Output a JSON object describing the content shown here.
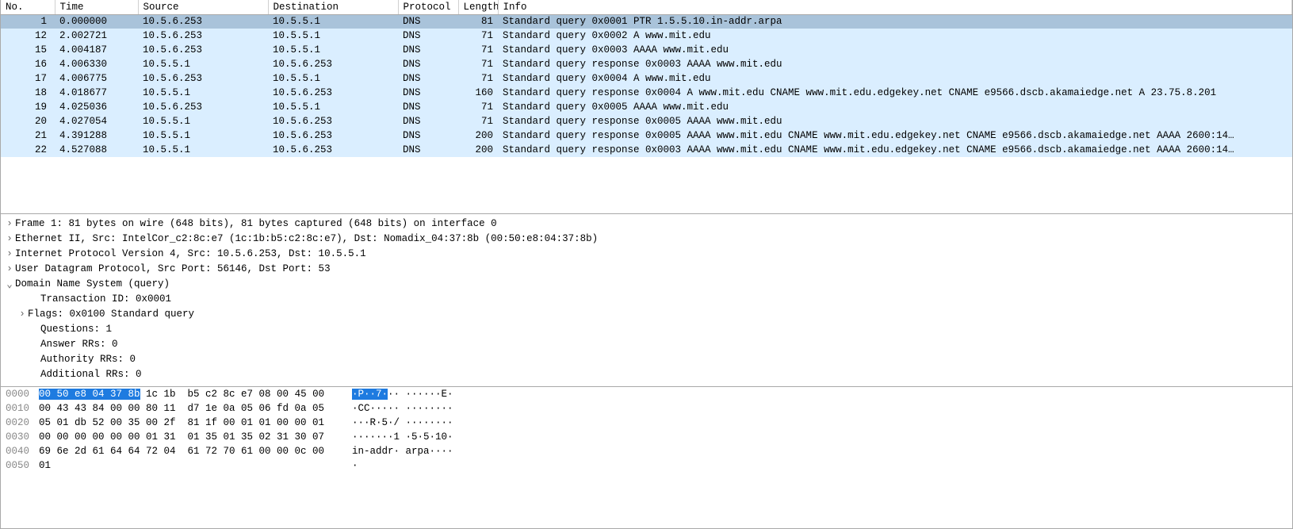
{
  "columns": {
    "no": "No.",
    "time": "Time",
    "src": "Source",
    "dst": "Destination",
    "proto": "Protocol",
    "len": "Length",
    "info": "Info"
  },
  "packets": [
    {
      "no": "1",
      "time": "0.000000",
      "src": "10.5.6.253",
      "dst": "10.5.5.1",
      "proto": "DNS",
      "len": "81",
      "info": "Standard query 0x0001 PTR 1.5.5.10.in-addr.arpa",
      "sel": true
    },
    {
      "no": "12",
      "time": "2.002721",
      "src": "10.5.6.253",
      "dst": "10.5.5.1",
      "proto": "DNS",
      "len": "71",
      "info": "Standard query 0x0002 A www.mit.edu"
    },
    {
      "no": "15",
      "time": "4.004187",
      "src": "10.5.6.253",
      "dst": "10.5.5.1",
      "proto": "DNS",
      "len": "71",
      "info": "Standard query 0x0003 AAAA www.mit.edu"
    },
    {
      "no": "16",
      "time": "4.006330",
      "src": "10.5.5.1",
      "dst": "10.5.6.253",
      "proto": "DNS",
      "len": "71",
      "info": "Standard query response 0x0003 AAAA www.mit.edu"
    },
    {
      "no": "17",
      "time": "4.006775",
      "src": "10.5.6.253",
      "dst": "10.5.5.1",
      "proto": "DNS",
      "len": "71",
      "info": "Standard query 0x0004 A www.mit.edu"
    },
    {
      "no": "18",
      "time": "4.018677",
      "src": "10.5.5.1",
      "dst": "10.5.6.253",
      "proto": "DNS",
      "len": "160",
      "info": "Standard query response 0x0004 A www.mit.edu CNAME www.mit.edu.edgekey.net CNAME e9566.dscb.akamaiedge.net A 23.75.8.201"
    },
    {
      "no": "19",
      "time": "4.025036",
      "src": "10.5.6.253",
      "dst": "10.5.5.1",
      "proto": "DNS",
      "len": "71",
      "info": "Standard query 0x0005 AAAA www.mit.edu"
    },
    {
      "no": "20",
      "time": "4.027054",
      "src": "10.5.5.1",
      "dst": "10.5.6.253",
      "proto": "DNS",
      "len": "71",
      "info": "Standard query response 0x0005 AAAA www.mit.edu"
    },
    {
      "no": "21",
      "time": "4.391288",
      "src": "10.5.5.1",
      "dst": "10.5.6.253",
      "proto": "DNS",
      "len": "200",
      "info": "Standard query response 0x0005 AAAA www.mit.edu CNAME www.mit.edu.edgekey.net CNAME e9566.dscb.akamaiedge.net AAAA 2600:14…"
    },
    {
      "no": "22",
      "time": "4.527088",
      "src": "10.5.5.1",
      "dst": "10.5.6.253",
      "proto": "DNS",
      "len": "200",
      "info": "Standard query response 0x0003 AAAA www.mit.edu CNAME www.mit.edu.edgekey.net CNAME e9566.dscb.akamaiedge.net AAAA 2600:14…"
    }
  ],
  "details": [
    {
      "expand": "closed",
      "indent": 0,
      "text": "Frame 1: 81 bytes on wire (648 bits), 81 bytes captured (648 bits) on interface 0"
    },
    {
      "expand": "closed",
      "indent": 0,
      "text": "Ethernet II, Src: IntelCor_c2:8c:e7 (1c:1b:b5:c2:8c:e7), Dst: Nomadix_04:37:8b (00:50:e8:04:37:8b)"
    },
    {
      "expand": "closed",
      "indent": 0,
      "text": "Internet Protocol Version 4, Src: 10.5.6.253, Dst: 10.5.5.1"
    },
    {
      "expand": "closed",
      "indent": 0,
      "text": "User Datagram Protocol, Src Port: 56146, Dst Port: 53"
    },
    {
      "expand": "open",
      "indent": 0,
      "text": "Domain Name System (query)"
    },
    {
      "expand": "none",
      "indent": 2,
      "text": "Transaction ID: 0x0001"
    },
    {
      "expand": "closed",
      "indent": 1,
      "text": "Flags: 0x0100 Standard query"
    },
    {
      "expand": "none",
      "indent": 2,
      "text": "Questions: 1"
    },
    {
      "expand": "none",
      "indent": 2,
      "text": "Answer RRs: 0"
    },
    {
      "expand": "none",
      "indent": 2,
      "text": "Authority RRs: 0"
    },
    {
      "expand": "none",
      "indent": 2,
      "text": "Additional RRs: 0"
    }
  ],
  "hex": [
    {
      "off": "0000",
      "b1": "00 50 e8 04 37 8b",
      "b1hl": true,
      "b2": " 1c 1b  b5 c2 8c e7 08 00 45 00",
      "a1": "·P··7·",
      "a1hl": true,
      "a2": "·· ······E·"
    },
    {
      "off": "0010",
      "b1": "00 43 43 84 00 00 80 11  d7 1e 0a 05 06 fd 0a 05",
      "a1": "·CC····· ········"
    },
    {
      "off": "0020",
      "b1": "05 01 db 52 00 35 00 2f  81 1f 00 01 01 00 00 01",
      "a1": "···R·5·/ ········"
    },
    {
      "off": "0030",
      "b1": "00 00 00 00 00 00 01 31  01 35 01 35 02 31 30 07",
      "a1": "·······1 ·5·5·10·"
    },
    {
      "off": "0040",
      "b1": "69 6e 2d 61 64 64 72 04  61 72 70 61 00 00 0c 00",
      "a1": "in-addr· arpa····"
    },
    {
      "off": "0050",
      "b1": "01",
      "a1": "·"
    }
  ]
}
